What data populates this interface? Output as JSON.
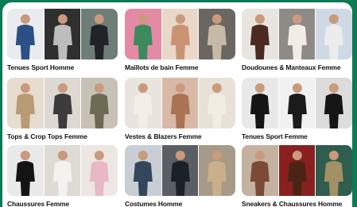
{
  "boards": [
    {
      "title": "Tenues Sport Homme",
      "photos": [
        {
          "bg": "#e9ecef",
          "fg": "#2c4f86"
        },
        {
          "bg": "#2f2f2f",
          "fg": "#bdbdbd"
        },
        {
          "bg": "#6f7d77",
          "fg": "#202428"
        }
      ]
    },
    {
      "title": "Maillots de bain Femme",
      "photos": [
        {
          "bg": "#e58aa5",
          "fg": "#3c8a5e"
        },
        {
          "bg": "#e9d7c8",
          "fg": "#c99373"
        },
        {
          "bg": "#6a6760",
          "fg": "#c8b9a6"
        }
      ]
    },
    {
      "title": "Doudounes & Manteaux Femme",
      "photos": [
        {
          "bg": "#e8e5e1",
          "fg": "#4b2a22"
        },
        {
          "bg": "#8e8a85",
          "fg": "#f1ede6"
        },
        {
          "bg": "#cfd9e6",
          "fg": "#ececec"
        }
      ]
    },
    {
      "title": "Tops & Crop Tops Femme",
      "photos": [
        {
          "bg": "#e6dccf",
          "fg": "#b89a74"
        },
        {
          "bg": "#ddd8d2",
          "fg": "#3b3b3b"
        },
        {
          "bg": "#c8c2b6",
          "fg": "#6d6a54"
        }
      ]
    },
    {
      "title": "Vestes & Blazers Femme",
      "photos": [
        {
          "bg": "#e9e4dd",
          "fg": "#f3efe8"
        },
        {
          "bg": "#d8b9a7",
          "fg": "#a97354"
        },
        {
          "bg": "#e7e1d8",
          "fg": "#f2ede3"
        }
      ]
    },
    {
      "title": "Tenues Sport Femme",
      "photos": [
        {
          "bg": "#e8e8e8",
          "fg": "#151515"
        },
        {
          "bg": "#f1f1f1",
          "fg": "#1b1b1b"
        },
        {
          "bg": "#dcdcdc",
          "fg": "#161616"
        }
      ]
    },
    {
      "title": "Chaussures Femme",
      "photos": [
        {
          "bg": "#e9e9e9",
          "fg": "#141414"
        },
        {
          "bg": "#dedad4",
          "fg": "#f4f2ef"
        },
        {
          "bg": "#ece7e3",
          "fg": "#e9b8c4"
        }
      ]
    },
    {
      "title": "Costumes Homme",
      "photos": [
        {
          "bg": "#c9ced4",
          "fg": "#34465c"
        },
        {
          "bg": "#5a5f66",
          "fg": "#1c2128"
        },
        {
          "bg": "#a89a88",
          "fg": "#c9b08a"
        }
      ]
    },
    {
      "title": "Sneakers & Chaussures Homme",
      "photos": [
        {
          "bg": "#c4b1a0",
          "fg": "#7a4b35"
        },
        {
          "bg": "#8a1f1f",
          "fg": "#4c2416"
        },
        {
          "bg": "#2f5d4e",
          "fg": "#a39064"
        }
      ]
    }
  ]
}
